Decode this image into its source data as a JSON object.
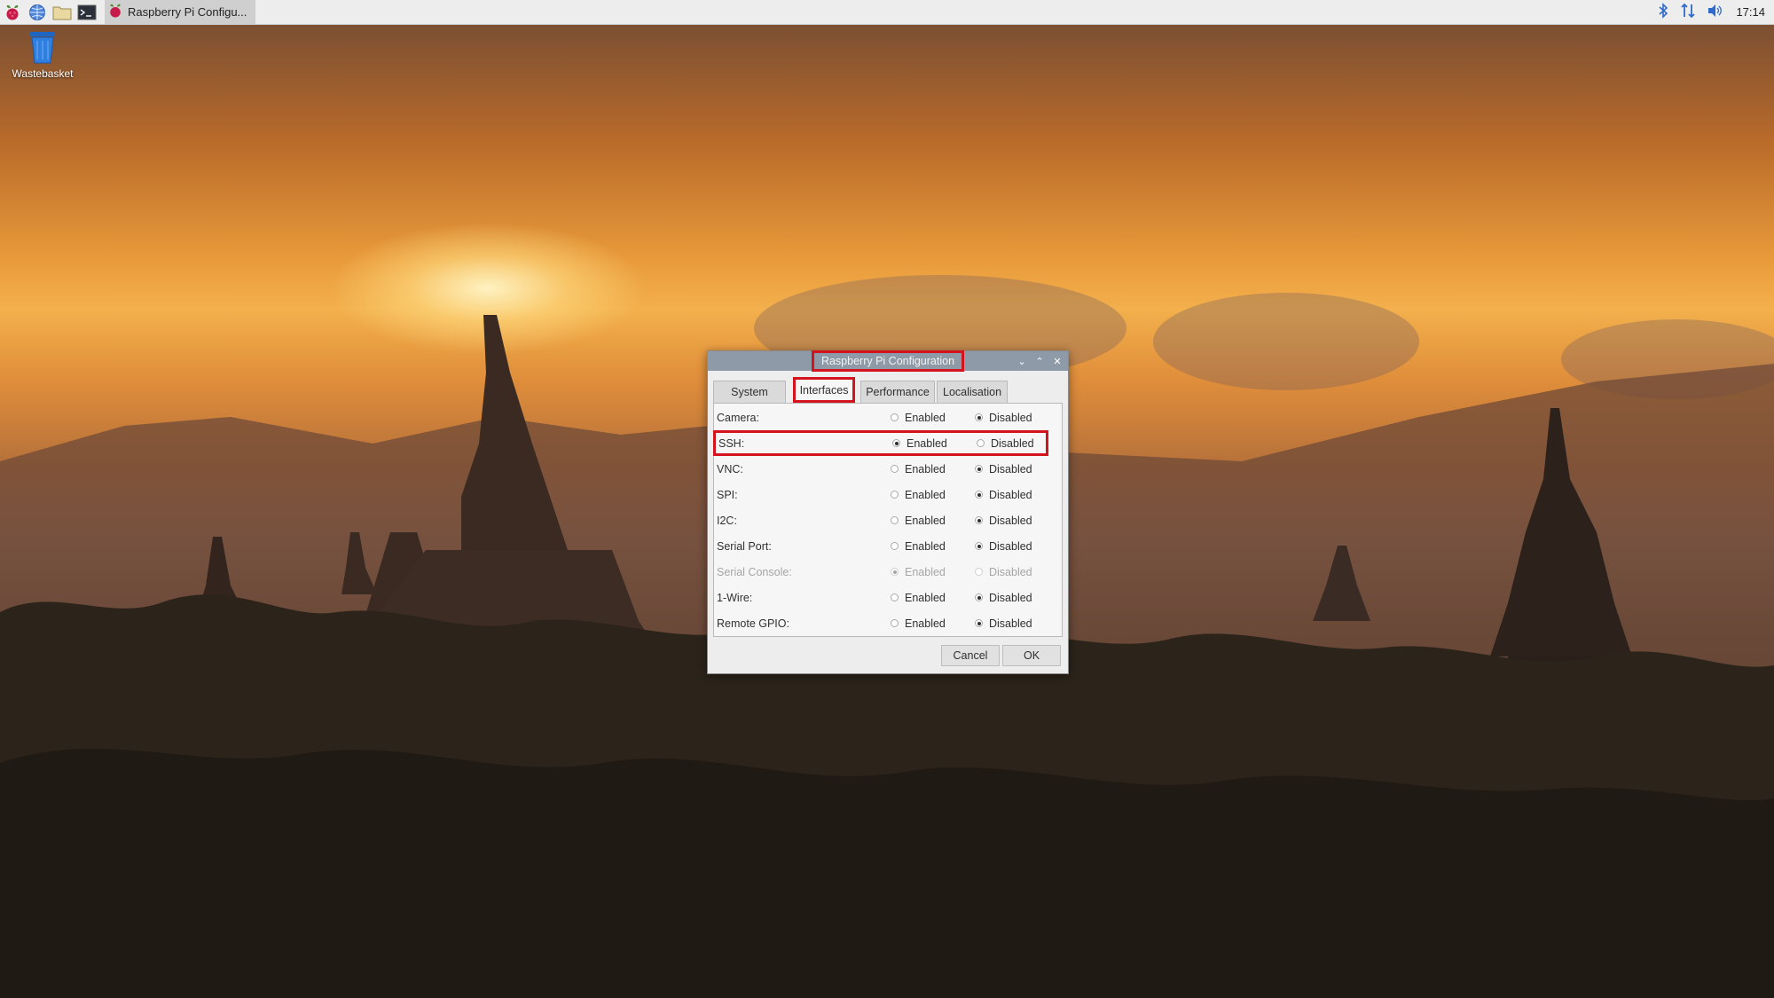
{
  "taskbar": {
    "launchers": [
      "raspberry-menu-icon",
      "web-browser-icon",
      "file-manager-icon",
      "terminal-icon"
    ],
    "task_label": "Raspberry Pi Configu...",
    "clock": "17:14"
  },
  "desktop": {
    "icons": [
      {
        "label": "Wastebasket",
        "icon": "wastebasket-icon"
      }
    ]
  },
  "dialog": {
    "title": "Raspberry Pi Configuration",
    "tabs": [
      {
        "label": "System",
        "active": false
      },
      {
        "label": "Interfaces",
        "active": true
      },
      {
        "label": "Performance",
        "active": false
      },
      {
        "label": "Localisation",
        "active": false
      }
    ],
    "option_labels": {
      "enabled": "Enabled",
      "disabled": "Disabled"
    },
    "rows": [
      {
        "label": "Camera:",
        "value": "Disabled",
        "greyed": false,
        "highlighted": false
      },
      {
        "label": "SSH:",
        "value": "Enabled",
        "greyed": false,
        "highlighted": true
      },
      {
        "label": "VNC:",
        "value": "Disabled",
        "greyed": false,
        "highlighted": false
      },
      {
        "label": "SPI:",
        "value": "Disabled",
        "greyed": false,
        "highlighted": false
      },
      {
        "label": "I2C:",
        "value": "Disabled",
        "greyed": false,
        "highlighted": false
      },
      {
        "label": "Serial Port:",
        "value": "Disabled",
        "greyed": false,
        "highlighted": false
      },
      {
        "label": "Serial Console:",
        "value": "Enabled",
        "greyed": true,
        "highlighted": false
      },
      {
        "label": "1-Wire:",
        "value": "Disabled",
        "greyed": false,
        "highlighted": false
      },
      {
        "label": "Remote GPIO:",
        "value": "Disabled",
        "greyed": false,
        "highlighted": false
      }
    ],
    "buttons": {
      "cancel": "Cancel",
      "ok": "OK"
    }
  },
  "colors": {
    "highlight": "#d3141e",
    "titlebar": "#8e9aa8",
    "raspberry": "#c51a4a"
  }
}
